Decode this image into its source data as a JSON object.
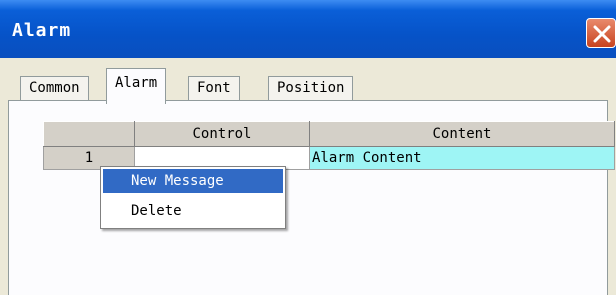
{
  "window": {
    "title": "Alarm",
    "close_icon": "close-x-icon",
    "accent_title_color": "#0653c8",
    "close_color": "#c8431f"
  },
  "tabs": [
    {
      "label": "Common",
      "active": false
    },
    {
      "label": "Alarm",
      "active": true
    },
    {
      "label": "Font",
      "active": false
    },
    {
      "label": "Position",
      "active": false
    }
  ],
  "grid": {
    "columns": [
      "",
      "Control",
      "Content"
    ],
    "rows": [
      {
        "index": "1",
        "control": "",
        "content": "Alarm Content"
      }
    ],
    "selected_cell_color": "#9ef5f5"
  },
  "context_menu": {
    "items": [
      {
        "label": "New Message",
        "selected": true
      },
      {
        "label": "Delete",
        "selected": false
      }
    ],
    "highlight_color": "#316ac5"
  }
}
